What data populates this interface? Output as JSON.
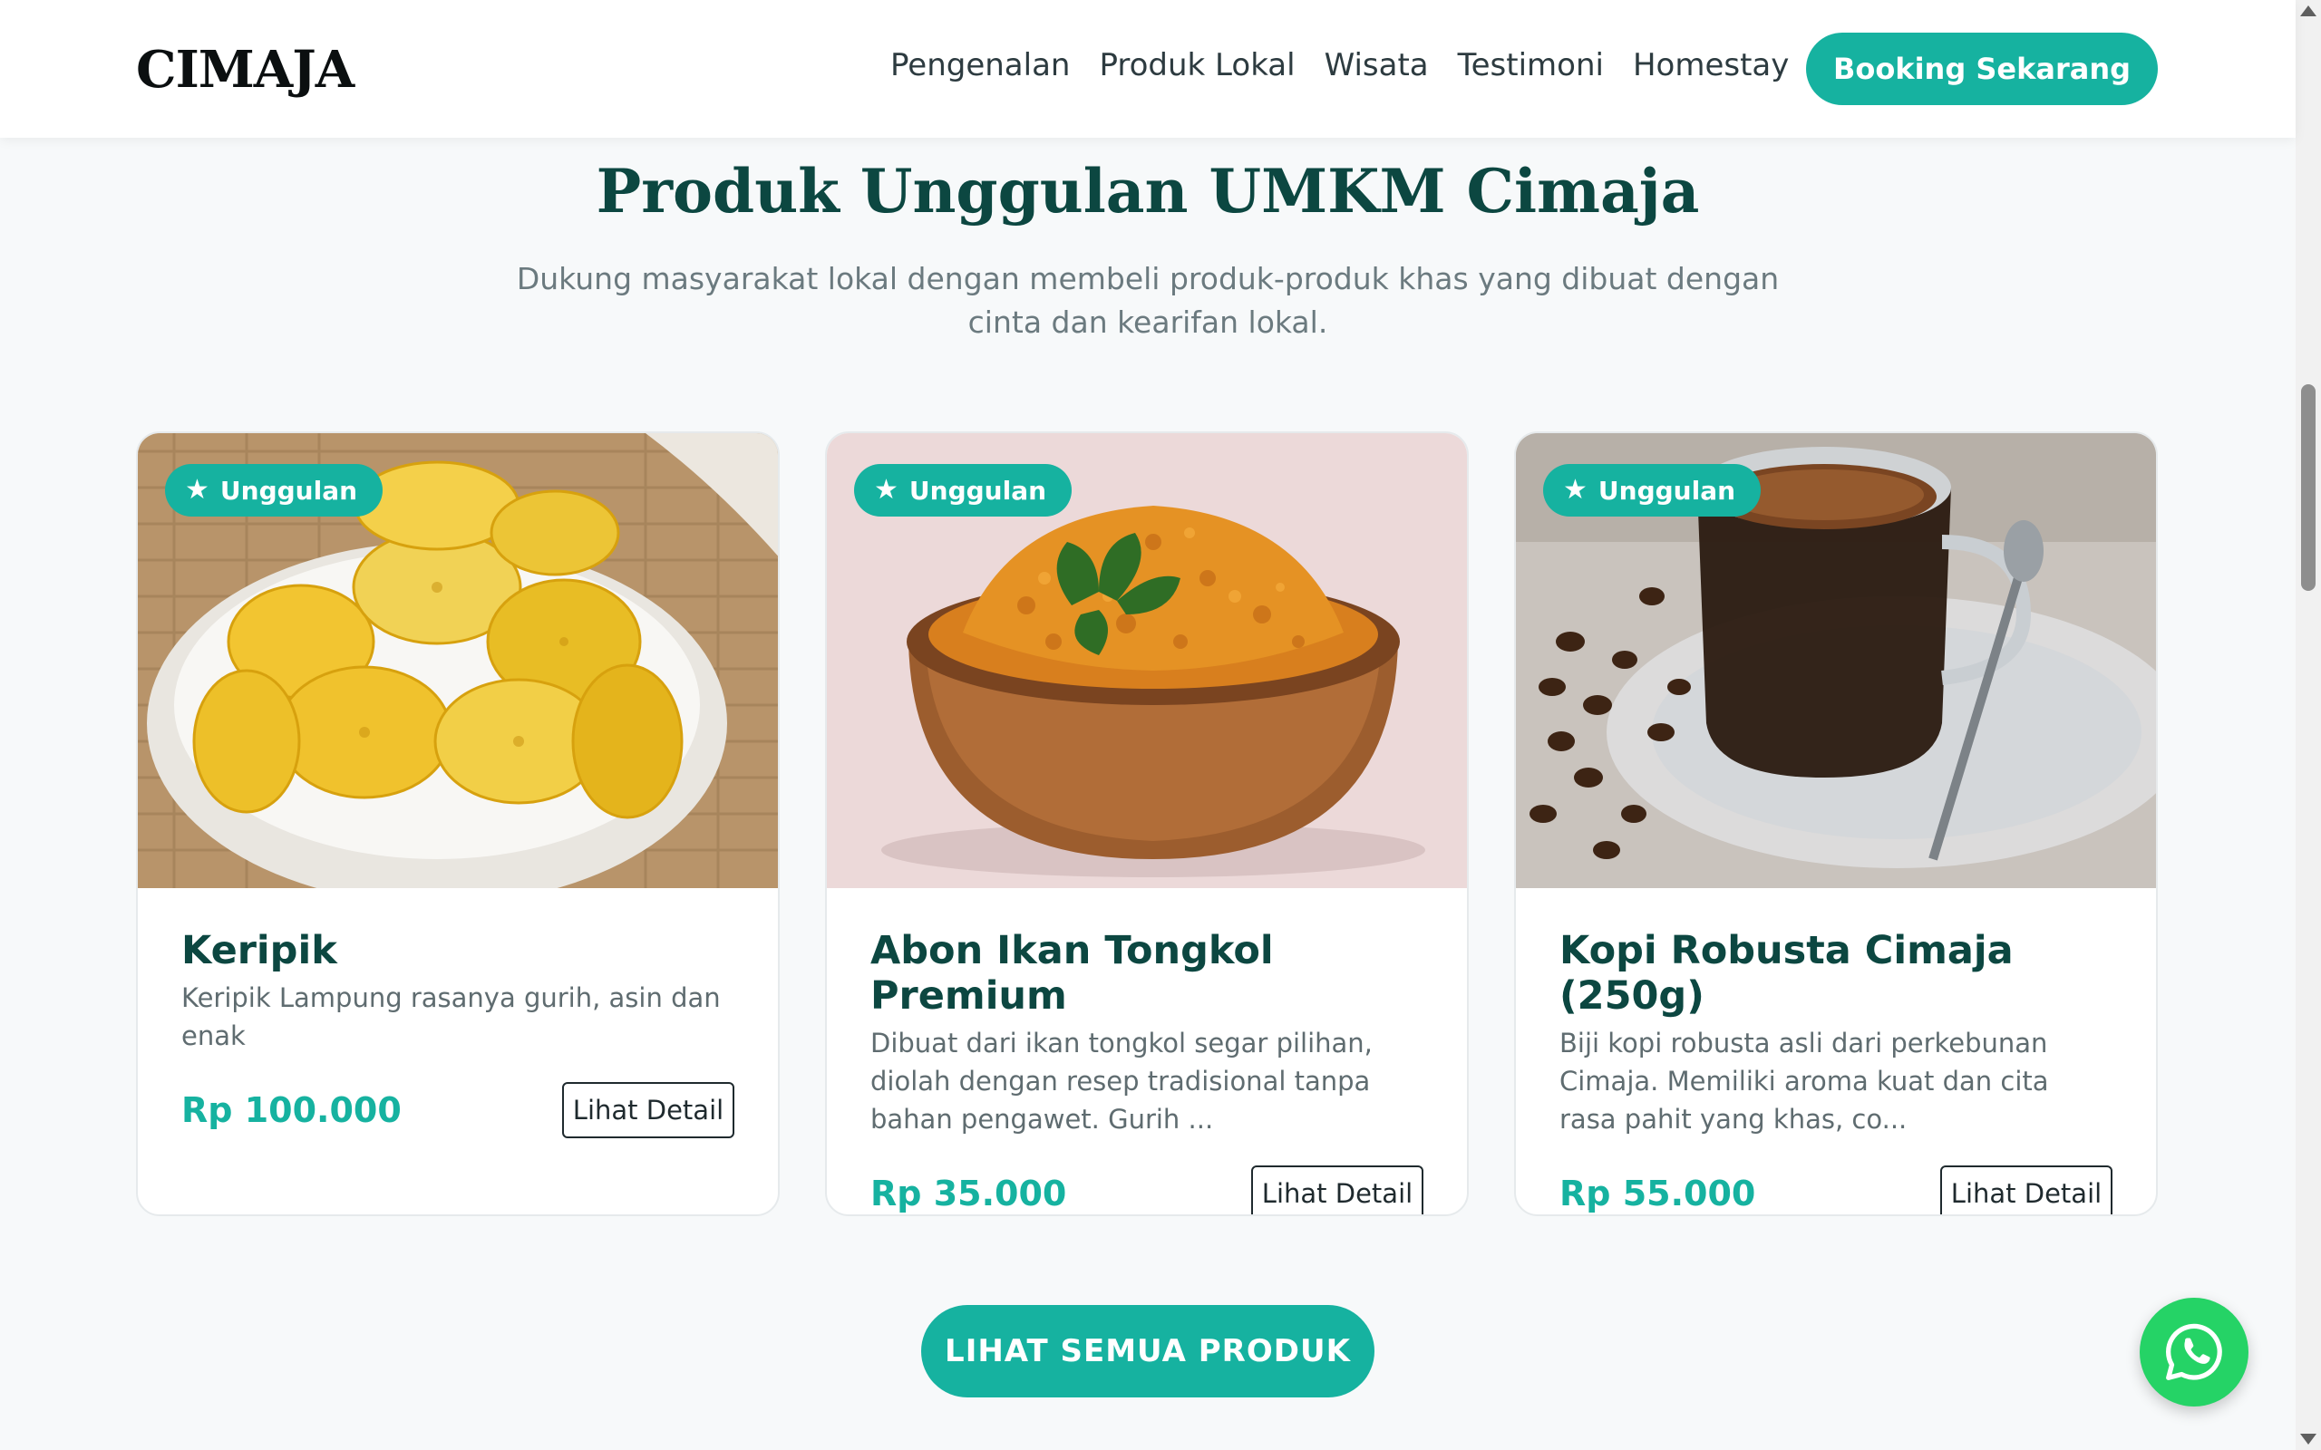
{
  "brand": "CIMAJA",
  "nav": {
    "links": [
      "Pengenalan",
      "Produk Lokal",
      "Wisata",
      "Testimoni",
      "Homestay"
    ],
    "cta": "Booking Sekarang"
  },
  "section": {
    "title": "Produk Unggulan UMKM Cimaja",
    "subtitle": "Dukung masyarakat lokal dengan membeli produk-produk khas yang dibuat dengan cinta dan kearifan lokal."
  },
  "products": [
    {
      "badge": "Unggulan",
      "image": "banana-chips-photo",
      "name": "Keripik",
      "description": "Keripik Lampung rasanya gurih, asin dan enak",
      "price": "Rp 100.000",
      "button": "Lihat Detail"
    },
    {
      "badge": "Unggulan",
      "image": "fish-floss-bowl-photo",
      "name": "Abon Ikan Tongkol Premium",
      "description": "Dibuat dari ikan tongkol segar pilihan, diolah dengan resep tradisional tanpa bahan pengawet. Gurih ...",
      "price": "Rp 35.000",
      "button": "Lihat Detail"
    },
    {
      "badge": "Unggulan",
      "image": "robusta-coffee-cup-photo",
      "name": "Kopi Robusta Cimaja (250g)",
      "description": "Biji kopi robusta asli dari perkebunan Cimaja. Memiliki aroma kuat dan cita rasa pahit yang khas, co...",
      "price": "Rp 55.000",
      "button": "Lihat Detail"
    }
  ],
  "all_products_button": "LIHAT SEMUA PRODUK",
  "floating": {
    "icon": "whatsapp-icon"
  },
  "colors": {
    "accent": "#16b2a0",
    "heading": "#0c4741",
    "whatsapp": "#25d366"
  }
}
